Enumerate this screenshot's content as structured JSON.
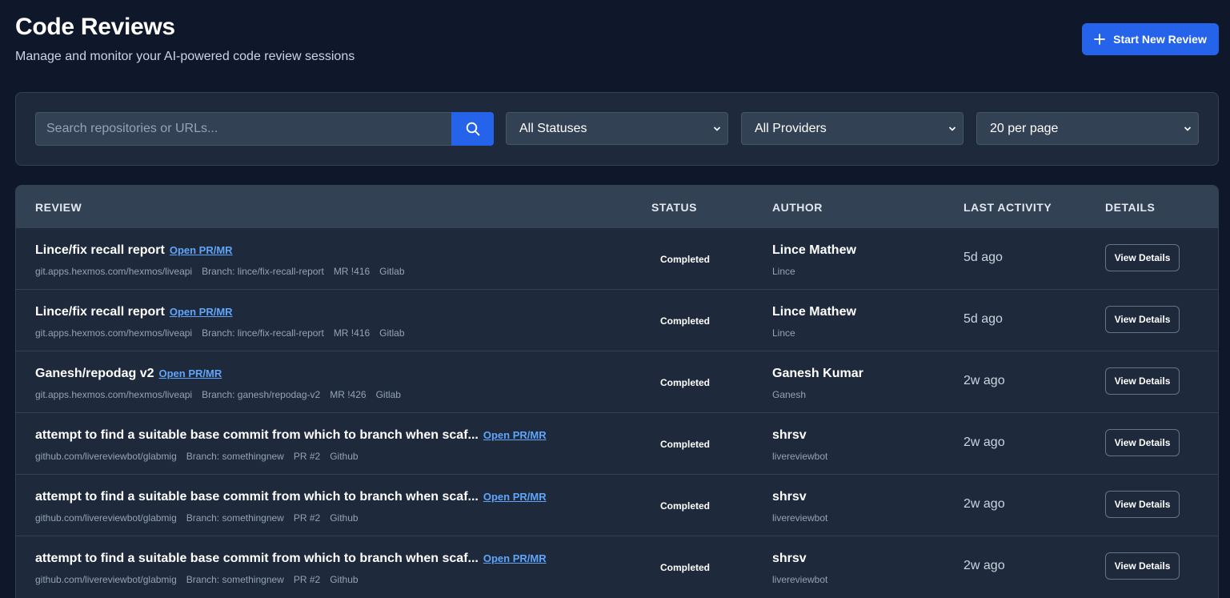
{
  "header": {
    "title": "Code Reviews",
    "subtitle": "Manage and monitor your AI-powered code review sessions",
    "new_button_label": "Start New Review",
    "new_button_icon": "plus-icon",
    "accent_color": "#2563eb"
  },
  "filters": {
    "search_placeholder": "Search repositories or URLs...",
    "search_value": "",
    "search_icon": "search-icon",
    "status_selected": "All Statuses",
    "provider_selected": "All Providers",
    "page_size_selected": "20 per page"
  },
  "table": {
    "columns": [
      "REVIEW",
      "STATUS",
      "AUTHOR",
      "LAST ACTIVITY",
      "DETAILS"
    ],
    "link_label": "Open PR/MR",
    "details_label": "View Details",
    "rows": [
      {
        "title": "Lince/fix recall report",
        "repo": "git.apps.hexmos.com/hexmos/liveapi",
        "branch": "Branch: lince/fix-recall-report",
        "ref": "MR !416",
        "provider": "Gitlab",
        "status": "Completed",
        "author": "Lince Mathew",
        "handle": "Lince",
        "activity": "5d ago"
      },
      {
        "title": "Lince/fix recall report",
        "repo": "git.apps.hexmos.com/hexmos/liveapi",
        "branch": "Branch: lince/fix-recall-report",
        "ref": "MR !416",
        "provider": "Gitlab",
        "status": "Completed",
        "author": "Lince Mathew",
        "handle": "Lince",
        "activity": "5d ago"
      },
      {
        "title": "Ganesh/repodag v2",
        "repo": "git.apps.hexmos.com/hexmos/liveapi",
        "branch": "Branch: ganesh/repodag-v2",
        "ref": "MR !426",
        "provider": "Gitlab",
        "status": "Completed",
        "author": "Ganesh Kumar",
        "handle": "Ganesh",
        "activity": "2w ago"
      },
      {
        "title": "attempt to find a suitable base commit from which to branch when scaf...",
        "repo": "github.com/livereviewbot/glabmig",
        "branch": "Branch: somethingnew",
        "ref": "PR #2",
        "provider": "Github",
        "status": "Completed",
        "author": "shrsv",
        "handle": "livereviewbot",
        "activity": "2w ago"
      },
      {
        "title": "attempt to find a suitable base commit from which to branch when scaf...",
        "repo": "github.com/livereviewbot/glabmig",
        "branch": "Branch: somethingnew",
        "ref": "PR #2",
        "provider": "Github",
        "status": "Completed",
        "author": "shrsv",
        "handle": "livereviewbot",
        "activity": "2w ago"
      },
      {
        "title": "attempt to find a suitable base commit from which to branch when scaf...",
        "repo": "github.com/livereviewbot/glabmig",
        "branch": "Branch: somethingnew",
        "ref": "PR #2",
        "provider": "Github",
        "status": "Completed",
        "author": "shrsv",
        "handle": "livereviewbot",
        "activity": "2w ago"
      }
    ]
  }
}
